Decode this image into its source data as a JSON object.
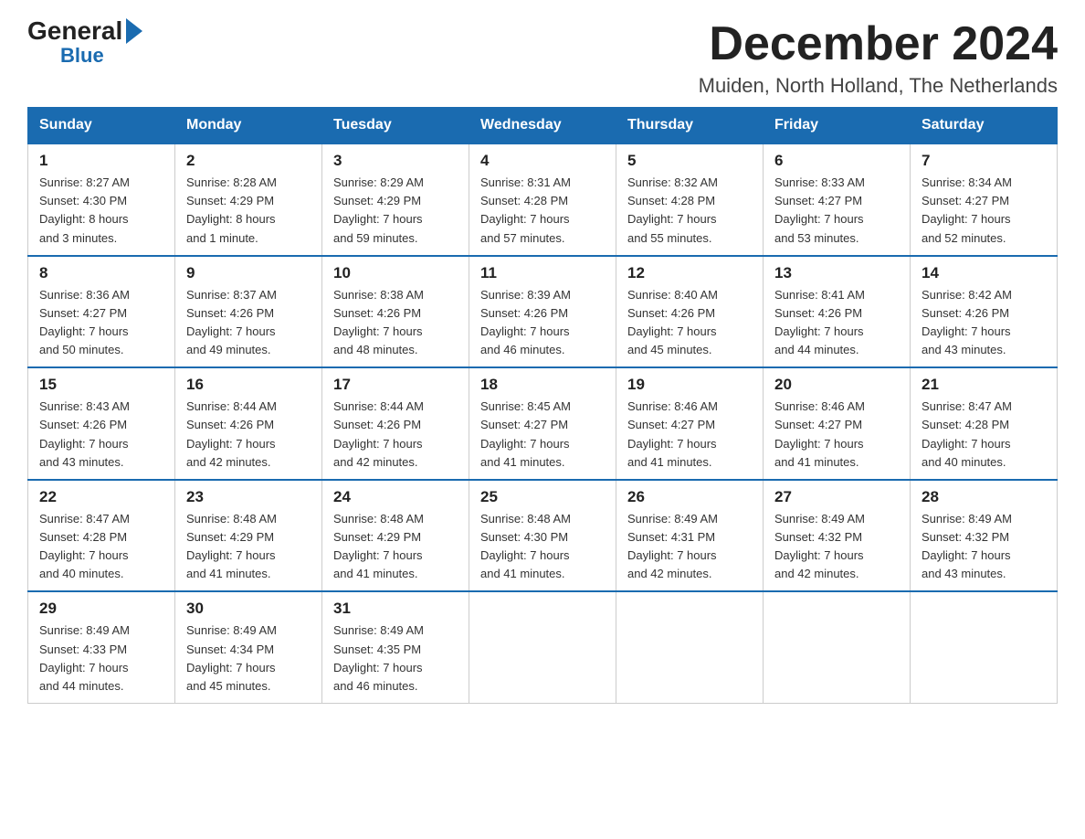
{
  "logo": {
    "general": "General",
    "triangle": "",
    "blue": "Blue"
  },
  "title": {
    "month": "December 2024",
    "location": "Muiden, North Holland, The Netherlands"
  },
  "weekdays": [
    "Sunday",
    "Monday",
    "Tuesday",
    "Wednesday",
    "Thursday",
    "Friday",
    "Saturday"
  ],
  "weeks": [
    [
      {
        "day": "1",
        "sunrise": "8:27 AM",
        "sunset": "4:30 PM",
        "daylight": "8 hours and 3 minutes."
      },
      {
        "day": "2",
        "sunrise": "8:28 AM",
        "sunset": "4:29 PM",
        "daylight": "8 hours and 1 minute."
      },
      {
        "day": "3",
        "sunrise": "8:29 AM",
        "sunset": "4:29 PM",
        "daylight": "7 hours and 59 minutes."
      },
      {
        "day": "4",
        "sunrise": "8:31 AM",
        "sunset": "4:28 PM",
        "daylight": "7 hours and 57 minutes."
      },
      {
        "day": "5",
        "sunrise": "8:32 AM",
        "sunset": "4:28 PM",
        "daylight": "7 hours and 55 minutes."
      },
      {
        "day": "6",
        "sunrise": "8:33 AM",
        "sunset": "4:27 PM",
        "daylight": "7 hours and 53 minutes."
      },
      {
        "day": "7",
        "sunrise": "8:34 AM",
        "sunset": "4:27 PM",
        "daylight": "7 hours and 52 minutes."
      }
    ],
    [
      {
        "day": "8",
        "sunrise": "8:36 AM",
        "sunset": "4:27 PM",
        "daylight": "7 hours and 50 minutes."
      },
      {
        "day": "9",
        "sunrise": "8:37 AM",
        "sunset": "4:26 PM",
        "daylight": "7 hours and 49 minutes."
      },
      {
        "day": "10",
        "sunrise": "8:38 AM",
        "sunset": "4:26 PM",
        "daylight": "7 hours and 48 minutes."
      },
      {
        "day": "11",
        "sunrise": "8:39 AM",
        "sunset": "4:26 PM",
        "daylight": "7 hours and 46 minutes."
      },
      {
        "day": "12",
        "sunrise": "8:40 AM",
        "sunset": "4:26 PM",
        "daylight": "7 hours and 45 minutes."
      },
      {
        "day": "13",
        "sunrise": "8:41 AM",
        "sunset": "4:26 PM",
        "daylight": "7 hours and 44 minutes."
      },
      {
        "day": "14",
        "sunrise": "8:42 AM",
        "sunset": "4:26 PM",
        "daylight": "7 hours and 43 minutes."
      }
    ],
    [
      {
        "day": "15",
        "sunrise": "8:43 AM",
        "sunset": "4:26 PM",
        "daylight": "7 hours and 43 minutes."
      },
      {
        "day": "16",
        "sunrise": "8:44 AM",
        "sunset": "4:26 PM",
        "daylight": "7 hours and 42 minutes."
      },
      {
        "day": "17",
        "sunrise": "8:44 AM",
        "sunset": "4:26 PM",
        "daylight": "7 hours and 42 minutes."
      },
      {
        "day": "18",
        "sunrise": "8:45 AM",
        "sunset": "4:27 PM",
        "daylight": "7 hours and 41 minutes."
      },
      {
        "day": "19",
        "sunrise": "8:46 AM",
        "sunset": "4:27 PM",
        "daylight": "7 hours and 41 minutes."
      },
      {
        "day": "20",
        "sunrise": "8:46 AM",
        "sunset": "4:27 PM",
        "daylight": "7 hours and 41 minutes."
      },
      {
        "day": "21",
        "sunrise": "8:47 AM",
        "sunset": "4:28 PM",
        "daylight": "7 hours and 40 minutes."
      }
    ],
    [
      {
        "day": "22",
        "sunrise": "8:47 AM",
        "sunset": "4:28 PM",
        "daylight": "7 hours and 40 minutes."
      },
      {
        "day": "23",
        "sunrise": "8:48 AM",
        "sunset": "4:29 PM",
        "daylight": "7 hours and 41 minutes."
      },
      {
        "day": "24",
        "sunrise": "8:48 AM",
        "sunset": "4:29 PM",
        "daylight": "7 hours and 41 minutes."
      },
      {
        "day": "25",
        "sunrise": "8:48 AM",
        "sunset": "4:30 PM",
        "daylight": "7 hours and 41 minutes."
      },
      {
        "day": "26",
        "sunrise": "8:49 AM",
        "sunset": "4:31 PM",
        "daylight": "7 hours and 42 minutes."
      },
      {
        "day": "27",
        "sunrise": "8:49 AM",
        "sunset": "4:32 PM",
        "daylight": "7 hours and 42 minutes."
      },
      {
        "day": "28",
        "sunrise": "8:49 AM",
        "sunset": "4:32 PM",
        "daylight": "7 hours and 43 minutes."
      }
    ],
    [
      {
        "day": "29",
        "sunrise": "8:49 AM",
        "sunset": "4:33 PM",
        "daylight": "7 hours and 44 minutes."
      },
      {
        "day": "30",
        "sunrise": "8:49 AM",
        "sunset": "4:34 PM",
        "daylight": "7 hours and 45 minutes."
      },
      {
        "day": "31",
        "sunrise": "8:49 AM",
        "sunset": "4:35 PM",
        "daylight": "7 hours and 46 minutes."
      },
      null,
      null,
      null,
      null
    ]
  ],
  "labels": {
    "sunrise": "Sunrise:",
    "sunset": "Sunset:",
    "daylight": "Daylight:"
  }
}
